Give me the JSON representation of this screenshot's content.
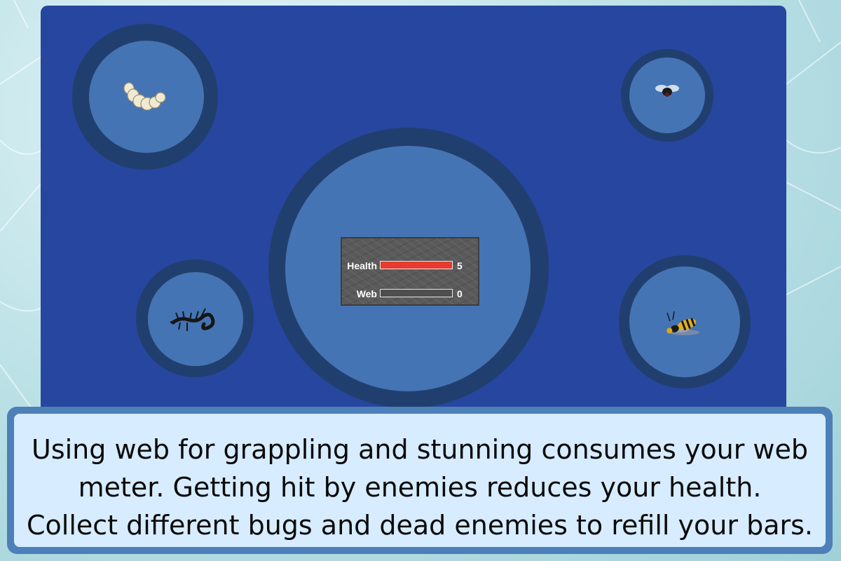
{
  "hud": {
    "health_label": "Health",
    "health_value": "5",
    "health_fill": 1.0,
    "health_color": "#e63b2e",
    "web_label": "Web",
    "web_value": "0",
    "web_fill": 0.0
  },
  "bugs": [
    {
      "name": "grub",
      "icon": "grub-icon"
    },
    {
      "name": "fly",
      "icon": "fly-icon"
    },
    {
      "name": "centipede",
      "icon": "centipede-icon"
    },
    {
      "name": "wasp",
      "icon": "wasp-icon"
    }
  ],
  "tutorial": {
    "line1": "Using web for grappling and stunning consumes your web",
    "line2": "meter. Getting hit by enemies reduces your health.",
    "line3": "Collect different bugs and dead enemies to refill your bars."
  },
  "colors": {
    "panel": "#2646a0",
    "ring": "#213f6e",
    "disc": "#4574b4",
    "tip_box": "#d7ecfe",
    "tip_border": "#4d80b8"
  }
}
